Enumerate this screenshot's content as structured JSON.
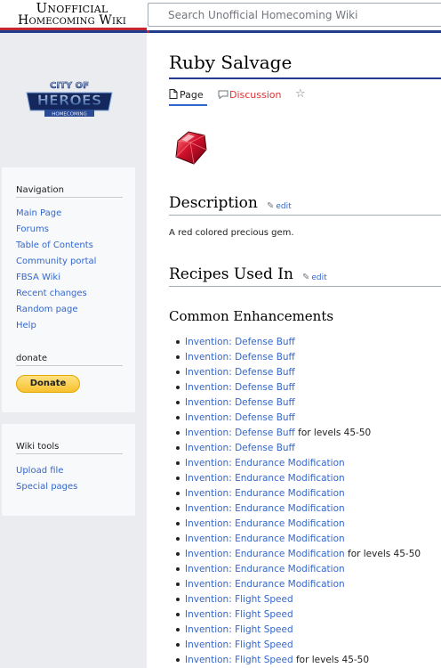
{
  "header": {
    "site_title_line1": "Unofficial",
    "site_title_line2": "Homecoming Wiki",
    "search_placeholder": "Search Unofficial Homecoming Wiki"
  },
  "sidebar": {
    "logo_text_top": "CITY OF",
    "logo_text_main": "HEROES",
    "logo_text_sub": "HOMECOMING",
    "navigation_heading": "Navigation",
    "navigation_items": [
      "Main Page",
      "Forums",
      "Table of Contents",
      "Community portal",
      "FBSA Wiki",
      "Recent changes",
      "Random page",
      "Help"
    ],
    "donate_heading": "donate",
    "donate_button": "Donate",
    "tools_heading": "Wiki tools",
    "tools_items": [
      "Upload file",
      "Special pages"
    ]
  },
  "page": {
    "title": "Ruby Salvage",
    "tabs": {
      "page": "Page",
      "discussion": "Discussion"
    },
    "description_heading": "Description",
    "edit_label": "edit",
    "description_text": "A red colored precious gem.",
    "recipes_heading": "Recipes Used In",
    "common_heading": "Common Enhancements",
    "recipes": [
      {
        "link": "Invention: Defense Buff",
        "suffix": ""
      },
      {
        "link": "Invention: Defense Buff",
        "suffix": ""
      },
      {
        "link": "Invention: Defense Buff",
        "suffix": ""
      },
      {
        "link": "Invention: Defense Buff",
        "suffix": ""
      },
      {
        "link": "Invention: Defense Buff",
        "suffix": ""
      },
      {
        "link": "Invention: Defense Buff",
        "suffix": ""
      },
      {
        "link": "Invention: Defense Buff",
        "suffix": " for levels 45-50"
      },
      {
        "link": "Invention: Defense Buff",
        "suffix": ""
      },
      {
        "link": "Invention: Endurance Modification",
        "suffix": ""
      },
      {
        "link": "Invention: Endurance Modification",
        "suffix": ""
      },
      {
        "link": "Invention: Endurance Modification",
        "suffix": ""
      },
      {
        "link": "Invention: Endurance Modification",
        "suffix": ""
      },
      {
        "link": "Invention: Endurance Modification",
        "suffix": ""
      },
      {
        "link": "Invention: Endurance Modification",
        "suffix": ""
      },
      {
        "link": "Invention: Endurance Modification",
        "suffix": " for levels 45-50"
      },
      {
        "link": "Invention: Endurance Modification",
        "suffix": ""
      },
      {
        "link": "Invention: Endurance Modification",
        "suffix": ""
      },
      {
        "link": "Invention: Flight Speed",
        "suffix": ""
      },
      {
        "link": "Invention: Flight Speed",
        "suffix": ""
      },
      {
        "link": "Invention: Flight Speed",
        "suffix": ""
      },
      {
        "link": "Invention: Flight Speed",
        "suffix": ""
      },
      {
        "link": "Invention: Flight Speed",
        "suffix": " for levels 45-50"
      }
    ]
  },
  "colors": {
    "link": "#3366cc",
    "discussion_tab": "#dd3333",
    "brand_red": "#c4262e",
    "brand_blue": "#233d8e",
    "donate_yellow": "#f7c12f"
  },
  "icons": {
    "page_tab": "page-icon",
    "discussion_tab": "speech-bubble-icon",
    "watch": "star-icon",
    "edit": "pencil-icon",
    "salvage": "ruby-gem-icon"
  }
}
